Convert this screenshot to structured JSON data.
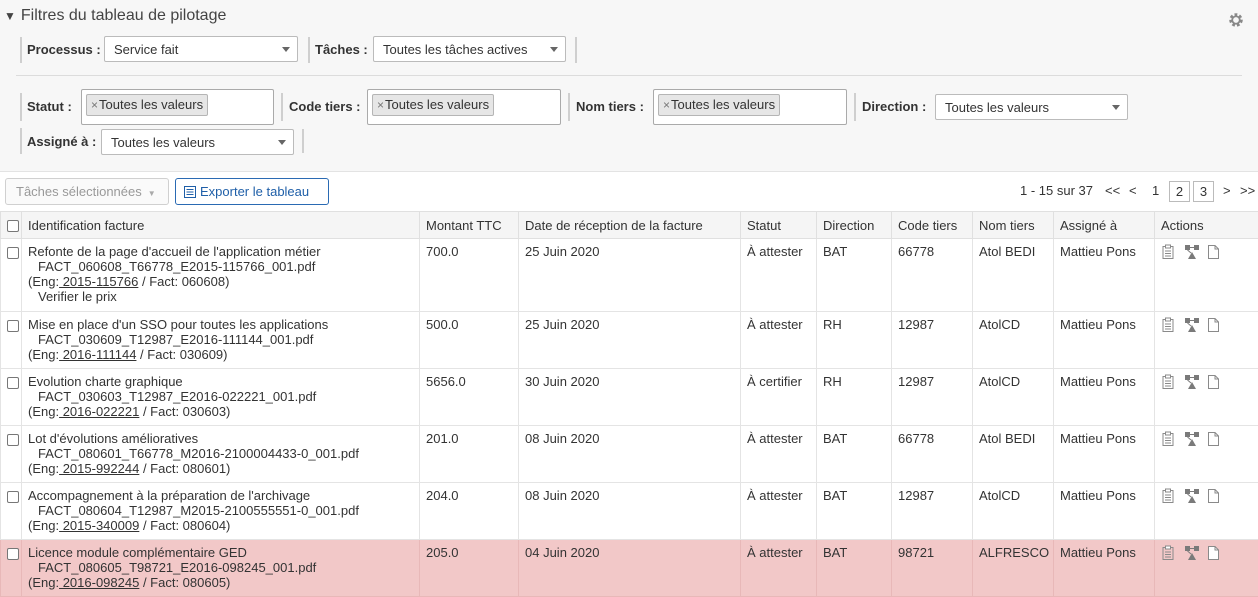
{
  "filters": {
    "title": "Filtres du tableau de pilotage",
    "processus_label": "Processus :",
    "processus_value": "Service fait",
    "taches_label": "Tâches :",
    "taches_value": "Toutes les tâches actives",
    "statut_label": "Statut :",
    "statut_chip": "Toutes les valeurs",
    "code_tiers_label": "Code tiers :",
    "code_tiers_chip": "Toutes les valeurs",
    "nom_tiers_label": "Nom tiers :",
    "nom_tiers_chip": "Toutes les valeurs",
    "direction_label": "Direction :",
    "direction_value": "Toutes les valeurs",
    "assigne_label": "Assigné à :",
    "assigne_value": "Toutes les valeurs",
    "chip_remove": "×"
  },
  "toolbar": {
    "taches_selectionnees": "Tâches sélectionnées",
    "exporter": "Exporter le tableau"
  },
  "pagination": {
    "summary": "1 - 15 sur 37",
    "first": "<<",
    "prev": "<",
    "pages": [
      "1",
      "2",
      "3"
    ],
    "next": ">",
    "last": ">>"
  },
  "table": {
    "columns": [
      "Identification facture",
      "Montant TTC",
      "Date de réception de la facture",
      "Statut",
      "Direction",
      "Code tiers",
      "Nom tiers",
      "Assigné à",
      "Actions"
    ],
    "rows": [
      {
        "title": "Refonte de la page d'accueil de l'application métier",
        "file": "FACT_060608_T66778_E2015-115766_001.pdf",
        "eng_prefix": "(Eng:",
        "eng": " 2015-115766",
        "fact": " / Fact: 060608)",
        "note": "Verifier le prix",
        "montant": "700.0",
        "date": "25 Juin 2020",
        "statut": "À attester",
        "direction": "BAT",
        "code": "66778",
        "nom": "Atol BEDI",
        "assigne": "Mattieu Pons"
      },
      {
        "title": "Mise en place d'un SSO pour toutes les applications",
        "file": "FACT_030609_T12987_E2016-111144_001.pdf",
        "eng_prefix": "(Eng:",
        "eng": " 2016-111144",
        "fact": " / Fact: 030609)",
        "note": "",
        "montant": "500.0",
        "date": "25 Juin 2020",
        "statut": "À attester",
        "direction": "RH",
        "code": "12987",
        "nom": "AtolCD",
        "assigne": "Mattieu Pons"
      },
      {
        "title": "Evolution charte graphique",
        "file": "FACT_030603_T12987_E2016-022221_001.pdf",
        "eng_prefix": "(Eng:",
        "eng": " 2016-022221",
        "fact": " / Fact: 030603)",
        "note": "",
        "montant": "5656.0",
        "date": "30 Juin 2020",
        "statut": "À certifier",
        "direction": "RH",
        "code": "12987",
        "nom": "AtolCD",
        "assigne": "Mattieu Pons"
      },
      {
        "title": "Lot d'évolutions amélioratives",
        "file": "FACT_080601_T66778_M2016-2100004433-0_001.pdf",
        "eng_prefix": "(Eng:",
        "eng": " 2015-992244",
        "fact": " / Fact: 080601)",
        "note": "",
        "montant": "201.0",
        "date": "08 Juin 2020",
        "statut": "À attester",
        "direction": "BAT",
        "code": "66778",
        "nom": "Atol BEDI",
        "assigne": "Mattieu Pons"
      },
      {
        "title": "Accompagnement à la préparation de l'archivage",
        "file": "FACT_080604_T12987_M2015-2100555551-0_001.pdf",
        "eng_prefix": "(Eng:",
        "eng": " 2015-340009",
        "fact": " / Fact: 080604)",
        "note": "",
        "montant": "204.0",
        "date": "08 Juin 2020",
        "statut": "À attester",
        "direction": "BAT",
        "code": "12987",
        "nom": "AtolCD",
        "assigne": "Mattieu Pons"
      },
      {
        "title": "Licence module complémentaire GED",
        "file": "FACT_080605_T98721_E2016-098245_001.pdf",
        "eng_prefix": "(Eng:",
        "eng": " 2016-098245",
        "fact": " / Fact: 080605)",
        "note": "",
        "montant": "205.0",
        "date": "04 Juin 2020",
        "statut": "À attester",
        "direction": "BAT",
        "code": "98721",
        "nom": "ALFRESCO",
        "assigne": "Mattieu Pons",
        "highlight": true
      }
    ]
  },
  "icons": {
    "gear": "gear-icon",
    "actions": [
      "clipboard-icon",
      "workflow-icon",
      "document-icon"
    ]
  },
  "colors": {
    "highlight_row": "#f2c8c8",
    "export_button": "#1f5fa8"
  }
}
